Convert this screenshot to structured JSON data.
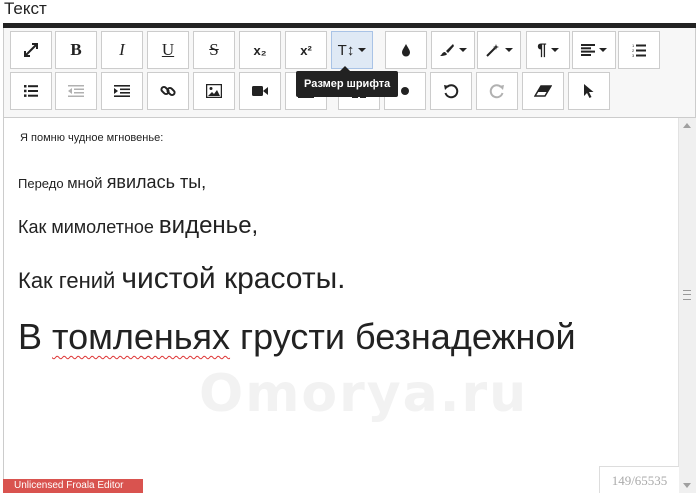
{
  "field_label": "Текст",
  "toolbar": {
    "row1": [
      {
        "name": "fullscreen-icon"
      },
      {
        "name": "bold-icon",
        "label": "B"
      },
      {
        "name": "italic-icon",
        "label": "I"
      },
      {
        "name": "underline-icon",
        "label": "U"
      },
      {
        "name": "strikethrough-icon",
        "label": "S"
      },
      {
        "name": "subscript-icon",
        "label": "x₂"
      },
      {
        "name": "superscript-icon",
        "label": "x²"
      },
      {
        "name": "font-size-icon",
        "label": "T↕"
      },
      {
        "name": "color-icon"
      },
      {
        "name": "paint-brush-icon"
      },
      {
        "name": "magic-icon"
      },
      {
        "name": "paragraph-icon",
        "label": "¶"
      },
      {
        "name": "align-icon"
      },
      {
        "name": "ordered-list-icon"
      }
    ],
    "row2": [
      {
        "name": "unordered-list-icon"
      },
      {
        "name": "outdent-icon"
      },
      {
        "name": "indent-icon"
      },
      {
        "name": "link-icon"
      },
      {
        "name": "image-icon"
      },
      {
        "name": "video-icon"
      },
      {
        "name": "table-icon"
      },
      {
        "name": "undo-icon"
      },
      {
        "name": "redo-icon"
      },
      {
        "name": "eraser-icon"
      },
      {
        "name": "pointer-icon"
      }
    ],
    "tooltip": "Размер шрифта"
  },
  "content": {
    "line1": "Я помню чудное мгновенье:",
    "line2a": "Передо ",
    "line2b": "мной ",
    "line2c": "явилась ",
    "line2d": "ты,",
    "line3a": "Как мимолетное ",
    "line3b": "виденье,",
    "line4a": "Как гений ",
    "line4b": "чистой красоты.",
    "line5a": "В ",
    "line5b": "томленьях",
    "line5c": " грусти безнадежной"
  },
  "watermark": "Omorya.ru",
  "license_badge": "Unlicensed Froala Editor",
  "char_counter": "149/65535"
}
